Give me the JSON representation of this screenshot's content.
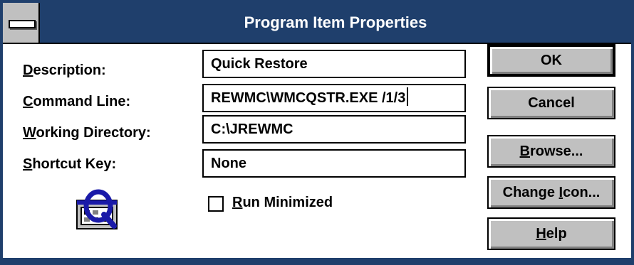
{
  "window": {
    "title": "Program Item Properties"
  },
  "labels": {
    "description": {
      "mnemonic": "D",
      "rest": "escription:"
    },
    "command_line": {
      "mnemonic": "C",
      "rest": "ommand Line:"
    },
    "working_directory": {
      "mnemonic": "W",
      "rest": "orking Directory:"
    },
    "shortcut_key": {
      "mnemonic": "S",
      "rest": "hortcut Key:"
    }
  },
  "fields": {
    "description": "Quick Restore",
    "command_line": "REWMC\\WMCQSTR.EXE /1/3",
    "working_directory": "C:\\JREWMC",
    "shortcut_key": "None"
  },
  "run_minimized": {
    "mnemonic": "R",
    "rest": "un Minimized",
    "checked": false
  },
  "buttons": {
    "ok": "OK",
    "cancel": "Cancel",
    "browse": {
      "mnemonic": "B",
      "rest": "rowse..."
    },
    "change_icon": {
      "before": "Change ",
      "mnemonic": "I",
      "rest": "con..."
    },
    "help": {
      "mnemonic": "H",
      "rest": "elp"
    }
  },
  "icon": {
    "name": "quick-restore-program-icon"
  },
  "colors": {
    "titlebar": "#1f3f6c",
    "button_face": "#c0c0c0",
    "icon_blue": "#1a1aa8"
  }
}
